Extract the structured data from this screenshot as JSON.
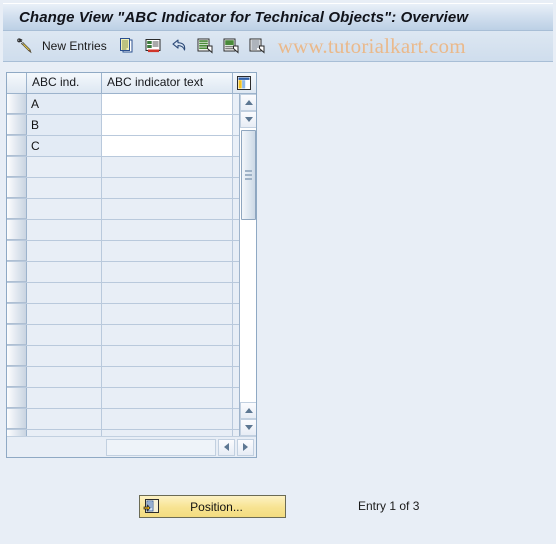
{
  "window": {
    "title": "Change View \"ABC Indicator for Technical Objects\": Overview",
    "background_color": "#e8eef6"
  },
  "toolbar": {
    "edit_icon": "pencil-display-change-icon",
    "new_entries_label": "New Entries",
    "buttons": [
      {
        "name": "copy-as-icon",
        "icon": "copy-as-icon"
      },
      {
        "name": "delete-icon",
        "icon": "delete-row-icon"
      },
      {
        "name": "undo-icon",
        "icon": "undo-arrow-icon"
      },
      {
        "name": "select-all-icon",
        "icon": "select-all-icon"
      },
      {
        "name": "deselect-all-icon",
        "icon": "deselect-all-icon"
      },
      {
        "name": "details-icon",
        "icon": "details-icon"
      }
    ]
  },
  "watermark": {
    "text": "www.tutorialkart.com",
    "color": "#eab98b"
  },
  "table": {
    "columns": [
      {
        "key": "abc_ind",
        "label": "ABC ind."
      },
      {
        "key": "abc_text",
        "label": "ABC indicator text"
      }
    ],
    "config_icon": "column-settings-icon",
    "rows": [
      {
        "abc_ind": "A",
        "abc_text": ""
      },
      {
        "abc_ind": "B",
        "abc_text": ""
      },
      {
        "abc_ind": "C",
        "abc_text": ""
      }
    ],
    "empty_row_count": 15
  },
  "scrollbars": {
    "vertical": {
      "up_arrow": "scroll-up-icon",
      "down_arrow": "scroll-down-icon",
      "page_up_arrow": "page-up-icon",
      "page_down_arrow": "page-down-icon",
      "thumb": "vertical-scroll-thumb"
    },
    "horizontal": {
      "left_arrow": "scroll-left-icon",
      "right_arrow": "scroll-right-icon"
    }
  },
  "footer": {
    "position_button": {
      "label": "Position...",
      "icon": "position-icon",
      "color": "#f7e391"
    },
    "entry_status": "Entry 1 of 3"
  }
}
